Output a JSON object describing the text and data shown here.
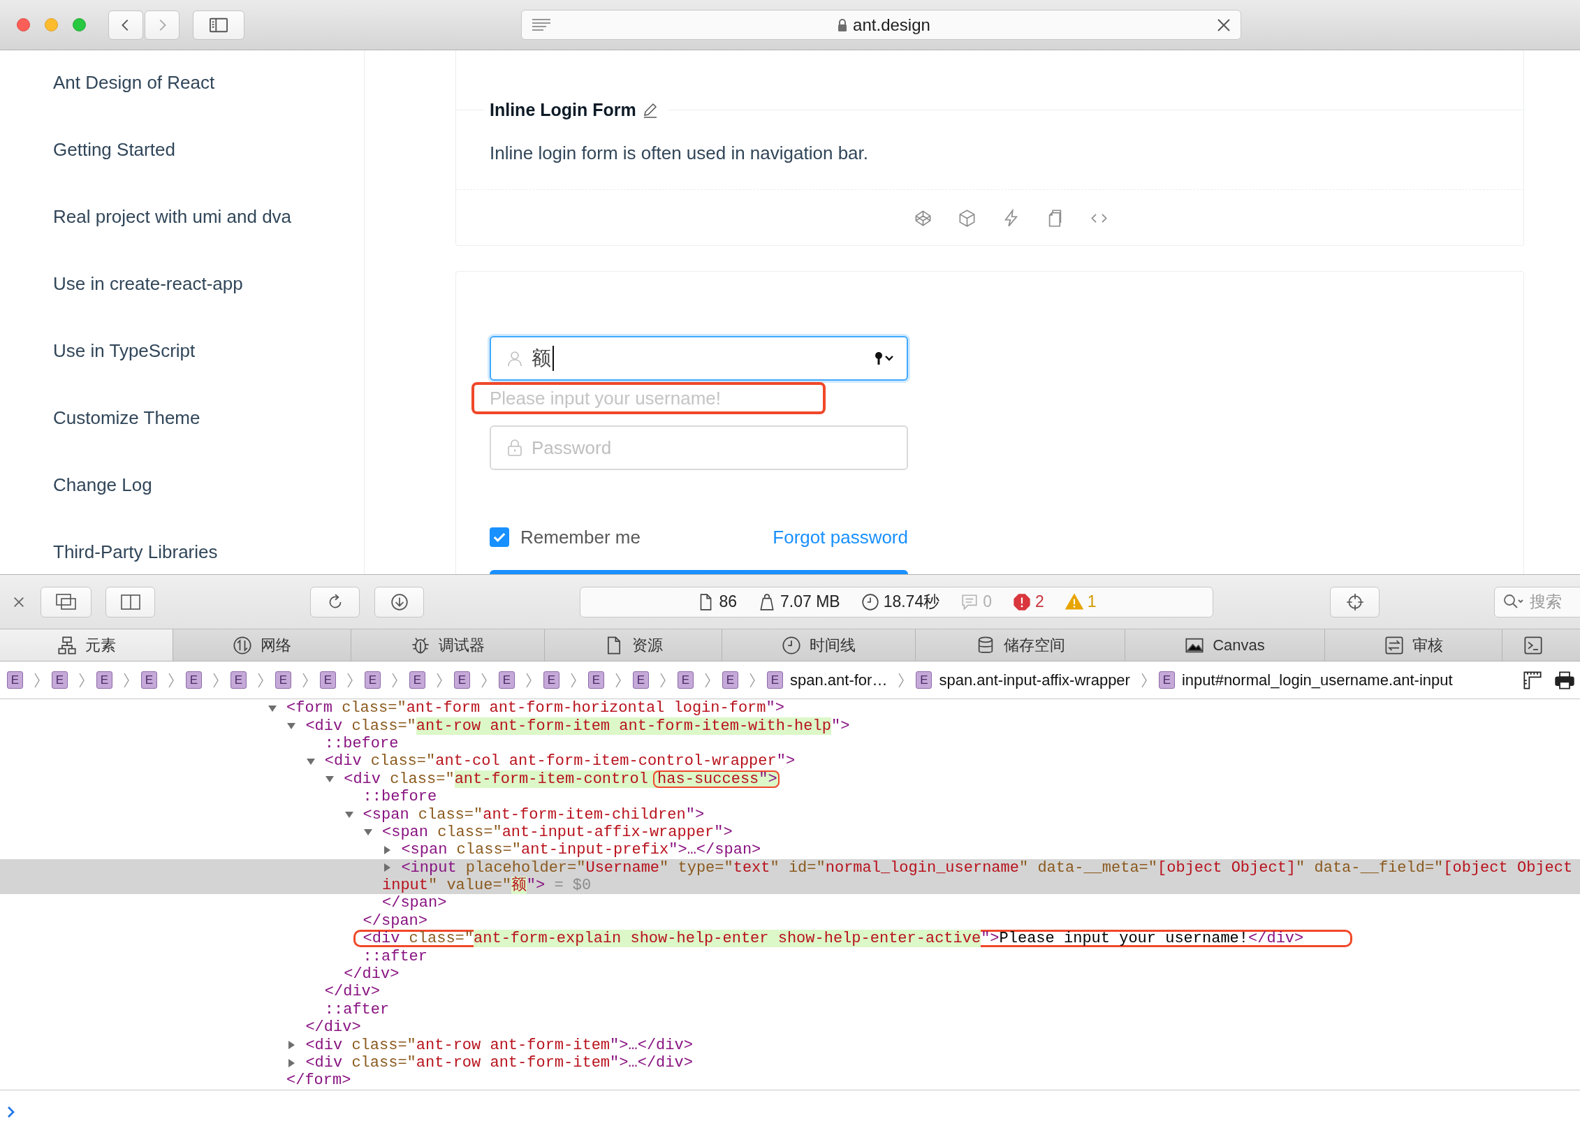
{
  "browser": {
    "url": "ant.design"
  },
  "sidebar": {
    "items": [
      "Ant Design of React",
      "Getting Started",
      "Real project with umi and dva",
      "Use in create-react-app",
      "Use in TypeScript",
      "Customize Theme",
      "Change Log",
      "Third-Party Libraries"
    ]
  },
  "demo": {
    "title": "Inline Login Form",
    "description": "Inline login form is often used in navigation bar."
  },
  "form": {
    "username": {
      "value": "额",
      "focused": true,
      "help": "Please input your username!",
      "help_circled": true
    },
    "password": {
      "placeholder": "Password"
    },
    "remember": {
      "label": "Remember me",
      "checked": true
    },
    "forgot_link": "Forgot password"
  },
  "devtools": {
    "stats": [
      {
        "kind": "resources",
        "text": "86"
      },
      {
        "kind": "size",
        "text": "7.07 MB"
      },
      {
        "kind": "time",
        "text": "18.74秒"
      },
      {
        "kind": "logs",
        "text": "0"
      },
      {
        "kind": "errors",
        "text": "2"
      },
      {
        "kind": "warnings",
        "text": "1"
      }
    ],
    "search": {
      "placeholder": "搜索"
    },
    "tabs": [
      {
        "kind": "elements",
        "label": "元素",
        "selected": true
      },
      {
        "kind": "network",
        "label": "网络",
        "selected": false
      },
      {
        "kind": "debugger",
        "label": "调试器",
        "selected": false
      },
      {
        "kind": "resources",
        "label": "资源",
        "selected": false
      },
      {
        "kind": "timeline",
        "label": "时间线",
        "selected": false
      },
      {
        "kind": "storage",
        "label": "储存空间",
        "selected": false
      },
      {
        "kind": "canvas",
        "label": "Canvas",
        "selected": false
      },
      {
        "kind": "audit",
        "label": "审核",
        "selected": false
      },
      {
        "kind": "console",
        "selected": false
      }
    ],
    "breadcrumb": [
      {
        "badge": "E"
      },
      {
        "badge": "E"
      },
      {
        "badge": "E"
      },
      {
        "badge": "E"
      },
      {
        "badge": "E"
      },
      {
        "badge": "E"
      },
      {
        "badge": "E"
      },
      {
        "badge": "E"
      },
      {
        "badge": "E"
      },
      {
        "badge": "E"
      },
      {
        "badge": "E"
      },
      {
        "badge": "E"
      },
      {
        "badge": "E"
      },
      {
        "badge": "E"
      },
      {
        "badge": "E"
      },
      {
        "badge": "E"
      },
      {
        "badge": "E"
      },
      {
        "badge": "E",
        "label": "span.ant-for…"
      },
      {
        "badge": "E",
        "label": "span.ant-input-affix-wrapper"
      },
      {
        "badge": "E",
        "label": "input#normal_login_username.ant-input"
      }
    ],
    "dom_tree": [
      {
        "open": [
          {
            "kind": "tag",
            "text": "<form"
          },
          {
            "kind": "attr",
            "text": " class=\""
          },
          {
            "kind": "value",
            "text": "ant-form ant-form-horizontal login-form"
          },
          {
            "kind": "tag",
            "text": "\">"
          }
        ],
        "expanded": true,
        "selected": false,
        "children": [
          {
            "open": [
              {
                "kind": "tag",
                "text": "<div"
              },
              {
                "kind": "attr",
                "text": " class=\""
              },
              {
                "kind": "hl",
                "text": "ant-row ant-form-item ant-form-item-with-help"
              },
              {
                "kind": "tag",
                "text": "\">"
              }
            ],
            "expanded": true,
            "selected": false,
            "children": [
              {
                "open": [
                  {
                    "kind": "pseudo",
                    "text": "::before"
                  }
                ],
                "selected": false
              },
              {
                "open": [
                  {
                    "kind": "tag",
                    "text": "<div"
                  },
                  {
                    "kind": "attr",
                    "text": " class=\""
                  },
                  {
                    "kind": "value",
                    "text": "ant-col ant-form-item-control-wrapper"
                  },
                  {
                    "kind": "tag",
                    "text": "\">"
                  }
                ],
                "expanded": true,
                "selected": false,
                "children": [
                  {
                    "open": [
                      {
                        "kind": "tag",
                        "text": "<div"
                      },
                      {
                        "kind": "attr",
                        "text": " class=\""
                      },
                      {
                        "kind": "hl",
                        "text": "ant-form-item-control "
                      },
                      {
                        "kind": "hl",
                        "text": "has-success",
                        "circled": true
                      },
                      {
                        "kind": "tag",
                        "text": "\">"
                      }
                    ],
                    "expanded": true,
                    "selected": false,
                    "children": [
                      {
                        "open": [
                          {
                            "kind": "pseudo",
                            "text": "::before"
                          }
                        ],
                        "selected": false
                      },
                      {
                        "open": [
                          {
                            "kind": "tag",
                            "text": "<span"
                          },
                          {
                            "kind": "attr",
                            "text": " class=\""
                          },
                          {
                            "kind": "value",
                            "text": "ant-form-item-children"
                          },
                          {
                            "kind": "tag",
                            "text": "\">"
                          }
                        ],
                        "expanded": true,
                        "selected": false,
                        "children": [
                          {
                            "open": [
                              {
                                "kind": "tag",
                                "text": "<span"
                              },
                              {
                                "kind": "attr",
                                "text": " class=\""
                              },
                              {
                                "kind": "value",
                                "text": "ant-input-affix-wrapper"
                              },
                              {
                                "kind": "tag",
                                "text": "\">"
                              }
                            ],
                            "expanded": true,
                            "selected": false,
                            "children": [
                              {
                                "open": [
                                  {
                                    "kind": "tag",
                                    "text": "<span"
                                  },
                                  {
                                    "kind": "attr",
                                    "text": " class=\""
                                  },
                                  {
                                    "kind": "value",
                                    "text": "ant-input-prefix"
                                  },
                                  {
                                    "kind": "tag",
                                    "text": "\">…</span>"
                                  }
                                ],
                                "expanded": false,
                                "selected": false
                              },
                              {
                                "open": [
                                  {
                                    "kind": "tag",
                                    "text": "<input"
                                  },
                                  {
                                    "kind": "attr",
                                    "text": " placeholder=\""
                                  },
                                  {
                                    "kind": "value",
                                    "text": "Username"
                                  },
                                  {
                                    "kind": "attr",
                                    "text": "\" type=\""
                                  },
                                  {
                                    "kind": "value",
                                    "text": "text"
                                  },
                                  {
                                    "kind": "attr",
                                    "text": "\" id=\""
                                  },
                                  {
                                    "kind": "value",
                                    "text": "normal_login_username"
                                  },
                                  {
                                    "kind": "attr",
                                    "text": "\" data-__meta=\""
                                  },
                                  {
                                    "kind": "value",
                                    "text": "[object Object]"
                                  },
                                  {
                                    "kind": "attr",
                                    "text": "\" data-__field=\""
                                  },
                                  {
                                    "kind": "value",
                                    "text": "[object Object"
                                  }
                                ],
                                "wrap": [
                                  {
                                    "kind": "value",
                                    "text": "input"
                                  },
                                  {
                                    "kind": "attr",
                                    "text": "\" value=\""
                                  },
                                  {
                                    "kind": "hl",
                                    "text": "额"
                                  },
                                  {
                                    "kind": "tag",
                                    "text": "\">"
                                  },
                                  {
                                    "kind": "dim",
                                    "text": " = $0"
                                  }
                                ],
                                "expanded": false,
                                "selected": true
                              }
                            ],
                            "close": [
                              {
                                "kind": "tag",
                                "text": "</span>"
                              }
                            ]
                          }
                        ],
                        "close": [
                          {
                            "kind": "tag",
                            "text": "</span>"
                          }
                        ]
                      },
                      {
                        "open": [
                          {
                            "kind": "tag",
                            "text": "<div"
                          },
                          {
                            "kind": "attr",
                            "text": " class=\""
                          },
                          {
                            "kind": "hl",
                            "text": "ant-form-explain show-help-enter show-help-enter-active"
                          },
                          {
                            "kind": "tag",
                            "text": "\">"
                          },
                          {
                            "kind": "text",
                            "text": "Please input your username!"
                          },
                          {
                            "kind": "tag",
                            "text": "</div>"
                          }
                        ],
                        "selected": false,
                        "circled": true
                      },
                      {
                        "open": [
                          {
                            "kind": "pseudo",
                            "text": "::after"
                          }
                        ],
                        "selected": false
                      }
                    ],
                    "close": [
                      {
                        "kind": "tag",
                        "text": "</div>"
                      }
                    ]
                  }
                ],
                "close": [
                  {
                    "kind": "tag",
                    "text": "</div>"
                  }
                ]
              },
              {
                "open": [
                  {
                    "kind": "pseudo",
                    "text": "::after"
                  }
                ],
                "selected": false
              }
            ],
            "close": [
              {
                "kind": "tag",
                "text": "</div>"
              }
            ]
          },
          {
            "open": [
              {
                "kind": "tag",
                "text": "<div"
              },
              {
                "kind": "attr",
                "text": " class=\""
              },
              {
                "kind": "value",
                "text": "ant-row ant-form-item"
              },
              {
                "kind": "tag",
                "text": "\">…</div>"
              }
            ],
            "expanded": false,
            "selected": false
          },
          {
            "open": [
              {
                "kind": "tag",
                "text": "<div"
              },
              {
                "kind": "attr",
                "text": " class=\""
              },
              {
                "kind": "value",
                "text": "ant-row ant-form-item"
              },
              {
                "kind": "tag",
                "text": "\">…</div>"
              }
            ],
            "expanded": false,
            "selected": false
          }
        ],
        "close": [
          {
            "kind": "tag",
            "text": "</form>"
          }
        ]
      }
    ]
  }
}
